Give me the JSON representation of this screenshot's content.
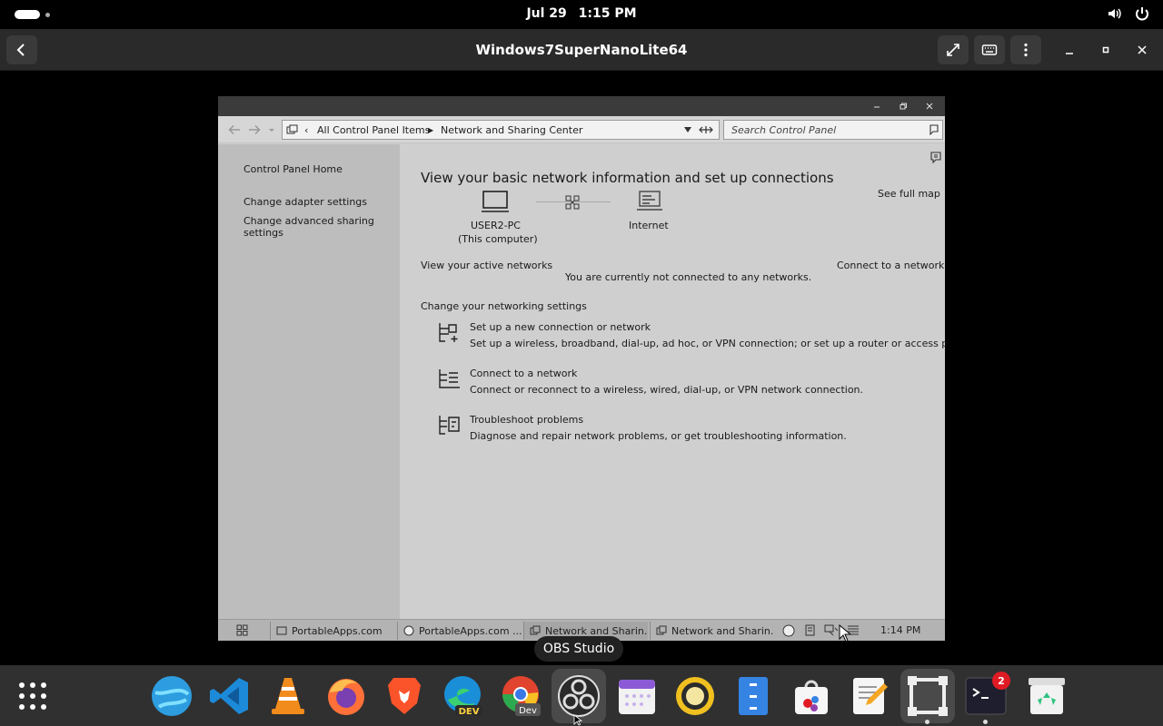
{
  "topbar": {
    "date": "Jul 29",
    "time": "1:15 PM"
  },
  "header": {
    "title": "Windows7SuperNanoLite64"
  },
  "vm": {
    "breadcrumb": [
      "All Control Panel Items",
      "Network and Sharing Center"
    ],
    "search_placeholder": "Search Control Panel",
    "sidebar": {
      "home": "Control Panel Home",
      "adapter": "Change adapter settings",
      "advanced": "Change advanced sharing settings"
    },
    "main": {
      "heading": "View your basic network information and set up connections",
      "see_full_map": "See full map",
      "computer_name": "USER2-PC",
      "computer_sub": "(This computer)",
      "internet": "Internet",
      "active_networks": "View your active networks",
      "connect_to_network": "Connect to a network",
      "not_connected": "You are currently not connected to any networks.",
      "change_settings": "Change your networking settings",
      "tasks": [
        {
          "title": "Set up a new connection or network",
          "desc": "Set up a wireless, broadband, dial-up, ad hoc, or VPN connection; or set up a router or access point."
        },
        {
          "title": "Connect to a network",
          "desc": "Connect or reconnect to a wireless, wired, dial-up, or VPN network connection."
        },
        {
          "title": "Troubleshoot problems",
          "desc": "Diagnose and repair network problems, or get troubleshooting information."
        }
      ]
    },
    "taskbar": {
      "items": [
        "PortableApps.com",
        "PortableApps.com ...",
        "Network and Sharin...",
        "Network and Sharin..."
      ],
      "clock": "1:14 PM"
    }
  },
  "tooltip": "OBS Studio",
  "dock": {
    "apps": [
      "show-apps",
      "browser",
      "vscode",
      "vlc",
      "firefox",
      "brave",
      "edge-dev",
      "chrome-dev",
      "obs-studio",
      "calendar",
      "rhythmbox",
      "files",
      "software",
      "text-editor",
      "boxes",
      "terminal",
      "trash"
    ],
    "terminal_badge": "2"
  }
}
